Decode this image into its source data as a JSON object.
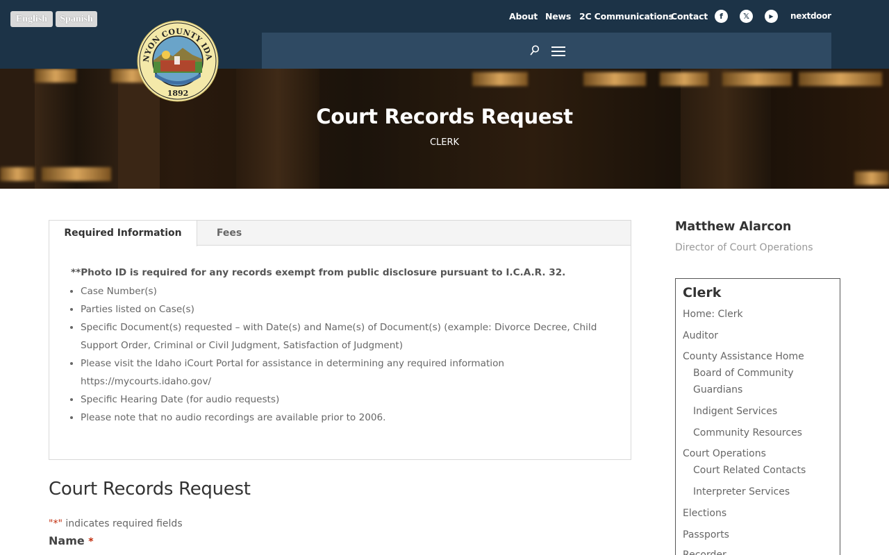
{
  "lang": {
    "english": "English",
    "spanish": "Spanish"
  },
  "seal": {
    "name": "CANYON COUNTY IDAHO",
    "year": "1892"
  },
  "topnav": {
    "about": "About",
    "news": "News",
    "communications": "2C Communications",
    "contact": "Contact",
    "facebook_glyph": "f",
    "x_glyph": "𝕏",
    "youtube_glyph": "▶",
    "nextdoor": "nextdoor"
  },
  "icons": {
    "search": "search-icon",
    "menu": "hamburger-menu-icon"
  },
  "hero": {
    "title": "Court Records Request",
    "subtitle": "CLERK"
  },
  "tabs": {
    "active": "Required Information",
    "inactive": "Fees"
  },
  "required": {
    "notice": "**Photo ID is required for any records exempt from public disclosure pursuant to I.C.A.R. 32.",
    "items": [
      "Case Number(s)",
      "Parties listed on Case(s)",
      "Specific Document(s) requested – with Date(s) and Name(s) of Document(s) (example: Divorce Decree, Child Support Order, Criminal or Civil Judgment, Satisfaction of Judgment)",
      "Please visit the Idaho iCourt Portal for assistance in determining any required information https://mycourts.idaho.gov/",
      "Specific Hearing Date (for audio requests)",
      "Please note that no audio recordings are available prior to 2006."
    ]
  },
  "form": {
    "title": "Court Records Request",
    "required_star": "\"*\"",
    "required_note": " indicates required fields",
    "name_label": "Name",
    "star": "*"
  },
  "sidebar": {
    "person_name": "Matthew Alarcon",
    "person_title": "Director of Court Operations",
    "heading": "Clerk",
    "links": [
      "Home: Clerk",
      "Auditor",
      "County Assistance Home",
      "Board of Community",
      "Guardians",
      "Indigent Services",
      "Community Resources",
      "Court Operations",
      "Court Related Contacts",
      "Interpreter Services",
      "Elections",
      "Passports",
      "Recorder"
    ]
  },
  "colors": {
    "header_bg": "#1c3347",
    "nav_panel": "#2f4a63",
    "required_star": "#c02b0a"
  }
}
